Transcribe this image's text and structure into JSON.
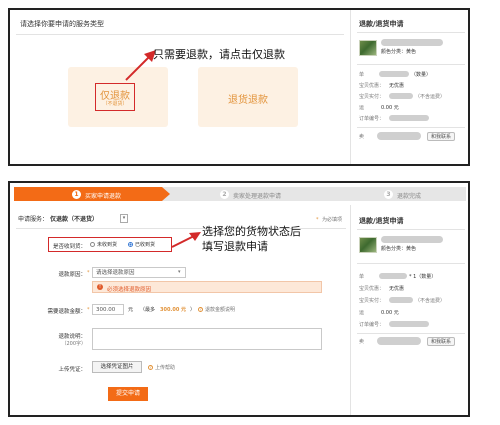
{
  "panel1": {
    "left_title": "请选择你要申请的服务类型",
    "annotation": "只需要退款，请点击仅退款",
    "option_refund_only": {
      "label": "仅退款",
      "sublabel": "（不退货）"
    },
    "option_return_refund": {
      "label": "退货退款"
    },
    "right": {
      "title": "退款/退货申请",
      "product_color": "颜色分类：黄色",
      "rows": [
        {
          "label": "单",
          "value": "（数量）"
        },
        {
          "label": "宝贝优惠：",
          "value": "无优惠"
        },
        {
          "label": "宝贝实付：",
          "value": "（不含运费）"
        },
        {
          "label": "运",
          "value": "0.00 元"
        },
        {
          "label": "订单编号：",
          "value": ""
        },
        {
          "label": "卖",
          "value": ""
        }
      ],
      "contact_btn": "和我联系"
    }
  },
  "panel2": {
    "steps": [
      {
        "num": "1",
        "label": "买家申请退款",
        "active": true
      },
      {
        "num": "2",
        "label": "卖家处理退款申请",
        "active": false
      },
      {
        "num": "3",
        "label": "退款完成",
        "active": false
      }
    ],
    "service_label": "申请服务：",
    "service_value": "仅退款（不退货）",
    "required_note": "为必填项",
    "received_label": "是否收到货：",
    "radio_not_received": "未收到货",
    "radio_received": "已收到货",
    "annotation_line1": "选择您的货物状态后",
    "annotation_line2": "填写退款申请",
    "reason_label": "退款原因：",
    "reason_placeholder": "请选择退款原因",
    "reason_warning": "必须选择退款原因",
    "amount_label": "需要退款金额：",
    "amount_value": "300.00",
    "amount_unit": "元",
    "amount_max_prefix": "（最多",
    "amount_max_value": "300.00 元",
    "amount_max_suffix": "）",
    "amount_help": "退款金额说明",
    "desc_label": "退款说明：",
    "desc_hint": "（200字）",
    "upload_label": "上传凭证：",
    "upload_btn": "选择凭证图片",
    "upload_help": "上传帮助",
    "submit_btn": "提交申请",
    "right": {
      "title": "退款/退货申请",
      "product_color": "颜色分类：黄色",
      "rows": [
        {
          "label": "单",
          "value": "* 1（数量）"
        },
        {
          "label": "宝贝优惠：",
          "value": "无优惠"
        },
        {
          "label": "宝贝实付：",
          "value": "（不含运费）"
        },
        {
          "label": "运",
          "value": "0.00 元"
        },
        {
          "label": "订单编号：",
          "value": ""
        },
        {
          "label": "卖",
          "value": ""
        }
      ],
      "contact_btn": "和我联系"
    }
  },
  "colors": {
    "accent_orange": "#f36b16",
    "card_bg": "#fdf1e3",
    "card_text": "#e2933a",
    "annotation_red": "#d32a2a"
  }
}
